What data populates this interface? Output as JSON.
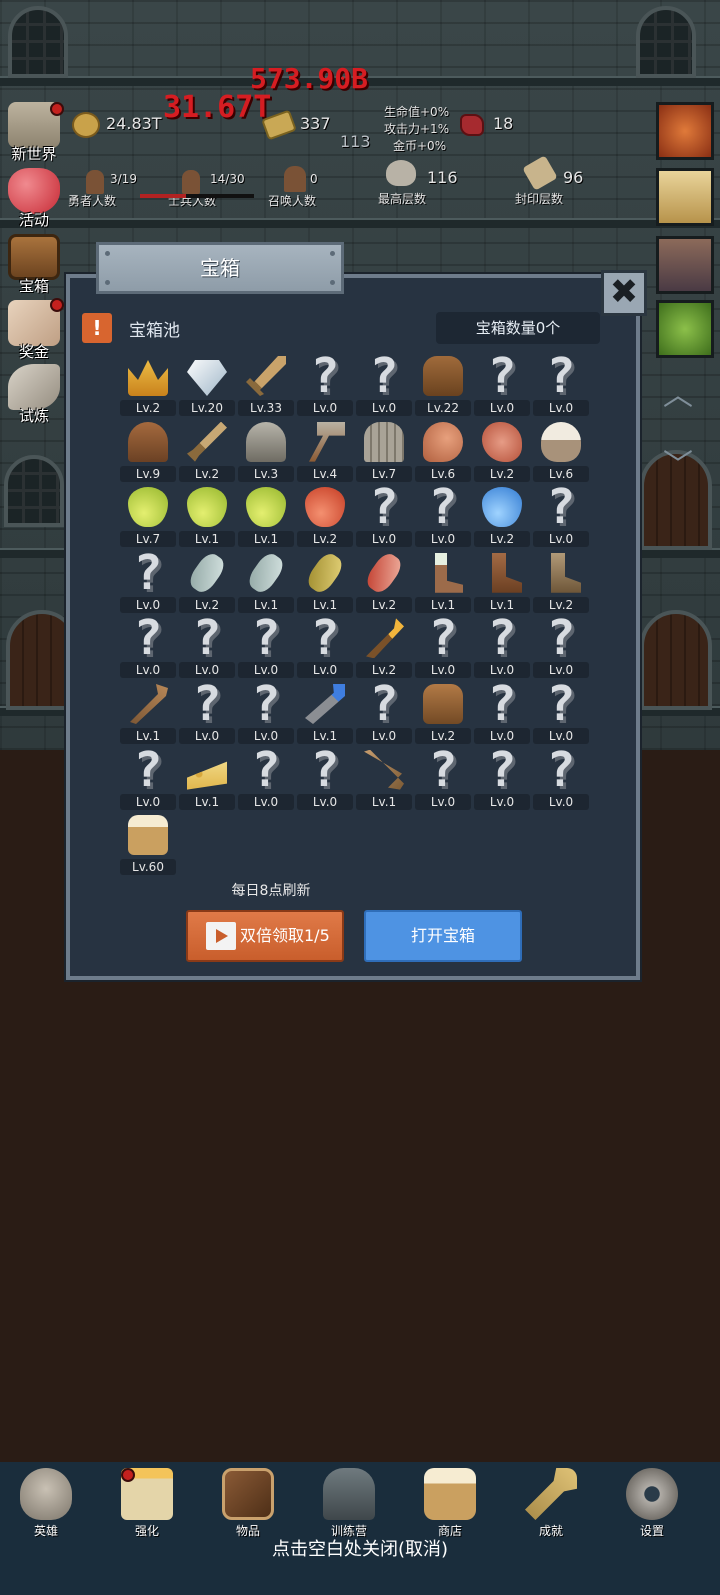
{
  "hud": {
    "gold": "24.83T",
    "gold_bars": "337",
    "center_number": "113",
    "meat": "18",
    "damage_big": "573.90B",
    "damage_small": "31.67T",
    "bonuses": [
      "生命值+0%",
      "攻击力+1%",
      "金币+0%"
    ],
    "hero_count": "3/19",
    "hero_label": "勇者人数",
    "soldier_count": "14/30",
    "soldier_label": "士兵人数",
    "summon_count": "0",
    "summon_label": "召唤人数",
    "max_floor": "116",
    "max_floor_label": "最高层数",
    "seal_floor": "96",
    "seal_floor_label": "封印层数"
  },
  "side_menu": [
    {
      "label": "新世界",
      "badge": true
    },
    {
      "label": "活动",
      "badge": false
    },
    {
      "label": "宝箱",
      "badge": false
    },
    {
      "label": "奖金",
      "badge": true
    },
    {
      "label": "试炼",
      "badge": false
    }
  ],
  "modal": {
    "title": "宝箱",
    "close_glyph": "✖",
    "pool_icon": "!",
    "pool_label": "宝箱池",
    "chest_count": "宝箱数量0个",
    "refresh_text": "每日8点刷新",
    "double_button": "双倍领取1/5",
    "open_button": "打开宝箱",
    "items": [
      {
        "icon": "crown-icon",
        "lv": "Lv.2"
      },
      {
        "icon": "diamond-icon",
        "lv": "Lv.20"
      },
      {
        "icon": "sword-icon",
        "lv": "Lv.33"
      },
      {
        "icon": "unknown-icon",
        "lv": "Lv.0"
      },
      {
        "icon": "unknown-icon",
        "lv": "Lv.0"
      },
      {
        "icon": "armor-icon",
        "lv": "Lv.22"
      },
      {
        "icon": "unknown-icon",
        "lv": "Lv.0"
      },
      {
        "icon": "unknown-icon",
        "lv": "Lv.0"
      },
      {
        "icon": "leather-helmet-icon",
        "lv": "Lv.9"
      },
      {
        "icon": "dagger-icon",
        "lv": "Lv.2"
      },
      {
        "icon": "iron-helmet-icon",
        "lv": "Lv.3"
      },
      {
        "icon": "hammer-icon",
        "lv": "Lv.4"
      },
      {
        "icon": "great-helm-icon",
        "lv": "Lv.7"
      },
      {
        "icon": "ham-icon",
        "lv": "Lv.6"
      },
      {
        "icon": "steak-icon",
        "lv": "Lv.2"
      },
      {
        "icon": "rice-bowl-icon",
        "lv": "Lv.6"
      },
      {
        "icon": "green-potion-icon",
        "lv": "Lv.7"
      },
      {
        "icon": "green-potion-icon",
        "lv": "Lv.1"
      },
      {
        "icon": "green-potion-icon",
        "lv": "Lv.1"
      },
      {
        "icon": "red-potion-icon",
        "lv": "Lv.2"
      },
      {
        "icon": "unknown-icon",
        "lv": "Lv.0"
      },
      {
        "icon": "unknown-icon",
        "lv": "Lv.0"
      },
      {
        "icon": "blue-potion-icon",
        "lv": "Lv.2"
      },
      {
        "icon": "unknown-icon",
        "lv": "Lv.0"
      },
      {
        "icon": "unknown-icon",
        "lv": "Lv.0"
      },
      {
        "icon": "empty-vial-icon",
        "lv": "Lv.2"
      },
      {
        "icon": "empty-vial-icon",
        "lv": "Lv.1"
      },
      {
        "icon": "yellow-bottle-icon",
        "lv": "Lv.1"
      },
      {
        "icon": "red-bottle-icon",
        "lv": "Lv.2"
      },
      {
        "icon": "winged-boot-icon",
        "lv": "Lv.1"
      },
      {
        "icon": "leather-boot-icon",
        "lv": "Lv.1"
      },
      {
        "icon": "worn-boot-icon",
        "lv": "Lv.2"
      },
      {
        "icon": "unknown-icon",
        "lv": "Lv.0"
      },
      {
        "icon": "unknown-icon",
        "lv": "Lv.0"
      },
      {
        "icon": "unknown-icon",
        "lv": "Lv.0"
      },
      {
        "icon": "unknown-icon",
        "lv": "Lv.0"
      },
      {
        "icon": "torch-icon",
        "lv": "Lv.2"
      },
      {
        "icon": "unknown-icon",
        "lv": "Lv.0"
      },
      {
        "icon": "unknown-icon",
        "lv": "Lv.0"
      },
      {
        "icon": "unknown-icon",
        "lv": "Lv.0"
      },
      {
        "icon": "wooden-staff-icon",
        "lv": "Lv.1"
      },
      {
        "icon": "unknown-icon",
        "lv": "Lv.0"
      },
      {
        "icon": "unknown-icon",
        "lv": "Lv.0"
      },
      {
        "icon": "blue-scepter-icon",
        "lv": "Lv.1"
      },
      {
        "icon": "unknown-icon",
        "lv": "Lv.0"
      },
      {
        "icon": "backpack-icon",
        "lv": "Lv.2"
      },
      {
        "icon": "unknown-icon",
        "lv": "Lv.0"
      },
      {
        "icon": "unknown-icon",
        "lv": "Lv.0"
      },
      {
        "icon": "unknown-icon",
        "lv": "Lv.0"
      },
      {
        "icon": "cheese-icon",
        "lv": "Lv.1"
      },
      {
        "icon": "unknown-icon",
        "lv": "Lv.0"
      },
      {
        "icon": "unknown-icon",
        "lv": "Lv.0"
      },
      {
        "icon": "bow-icon",
        "lv": "Lv.1"
      },
      {
        "icon": "unknown-icon",
        "lv": "Lv.0"
      },
      {
        "icon": "unknown-icon",
        "lv": "Lv.0"
      },
      {
        "icon": "unknown-icon",
        "lv": "Lv.0"
      },
      {
        "icon": "beer-mug-icon",
        "lv": "Lv.60"
      }
    ]
  },
  "bottom_nav": [
    {
      "label": "英雄",
      "icon": "skull-icon",
      "badge": false
    },
    {
      "label": "强化",
      "icon": "candle-icon",
      "badge": true
    },
    {
      "label": "物品",
      "icon": "book-icon",
      "badge": false
    },
    {
      "label": "训练营",
      "icon": "lantern-icon",
      "badge": false
    },
    {
      "label": "商店",
      "icon": "beer-mug-icon",
      "badge": false
    },
    {
      "label": "成就",
      "icon": "key-icon",
      "badge": false
    },
    {
      "label": "设置",
      "icon": "gear-icon",
      "badge": false
    }
  ],
  "close_hint": "点击空白处关闭(取消)",
  "colors": {
    "modal_bg": "#273341",
    "modal_border": "#6e7c8b",
    "orange_button": "#d96a38",
    "blue_button": "#4e93e3",
    "damage_red": "#d61d22",
    "nav_bg": "#1a2d3c"
  }
}
